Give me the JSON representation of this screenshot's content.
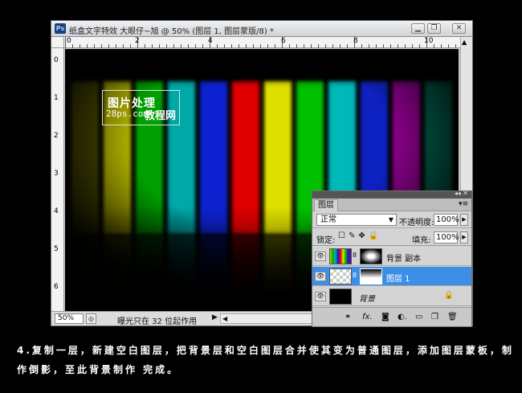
{
  "document": {
    "title": "纸盒文字特效 大眼仔~旭 @ 50% (图层 1, 图层蒙版/8) *",
    "app_badge": "Ps",
    "ruler_h_labels": [
      "0",
      "2",
      "4",
      "6",
      "8",
      "10"
    ],
    "ruler_v_labels": [
      "0",
      "1",
      "2",
      "3",
      "4",
      "5",
      "6"
    ],
    "zoom": "50%",
    "status_text": "曝光只在 32 位起作用",
    "window_buttons": [
      "minimize-icon",
      "restore-icon",
      "close-icon"
    ]
  },
  "watermark": {
    "line1": "图片处理",
    "line2": "28ps.com",
    "line3": "教程网"
  },
  "canvas": {
    "bar_colors": [
      "#4a4a00",
      "#b0b000",
      "#00a000",
      "#00a8a8",
      "#1020d0",
      "#e00000",
      "#e0e000",
      "#00c000",
      "#00b8b8",
      "#1020c0",
      "#8a008a",
      "#006050"
    ]
  },
  "layers_panel": {
    "tab": "图层",
    "blend_mode": "正常",
    "opacity_label": "不透明度:",
    "opacity": "100%",
    "lock_label": "锁定:",
    "fill_label": "填充:",
    "fill": "100%",
    "layers": [
      {
        "name": "背景 副本",
        "selected": false
      },
      {
        "name": "图层 1",
        "selected": true
      },
      {
        "name": "背景",
        "selected": false
      }
    ]
  },
  "caption": {
    "text": "4.复制一层，新建空白图层，把背景层和空白图层合并使其变为普通图层，添加图层蒙板，制作倒影，至此背景制作 完成。"
  }
}
